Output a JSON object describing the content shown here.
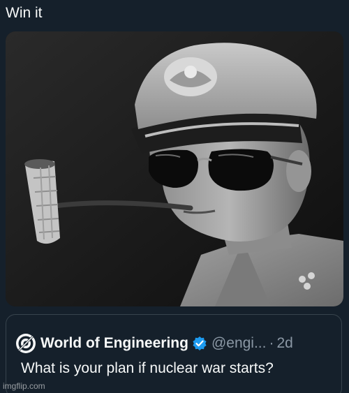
{
  "post": {
    "text": "Win it"
  },
  "quote": {
    "author_name": "World of Engineering",
    "handle": "@engi...",
    "separator": "·",
    "age": "2d",
    "text": "What is your plan if nuclear war starts?"
  },
  "watermark": "imgflip.com",
  "icons": {
    "avatar": "gear-logo-icon",
    "verified": "verified-badge-icon"
  },
  "colors": {
    "background": "#15202b",
    "text": "#f7f9f9",
    "muted": "#8b98a5",
    "border": "#38444d",
    "verified": "#1d9bf0"
  }
}
